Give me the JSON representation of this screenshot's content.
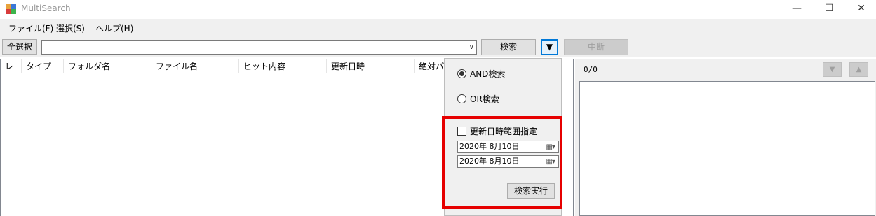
{
  "window": {
    "title": "MultiSearch",
    "minimize_glyph": "—",
    "maximize_glyph": "☐",
    "close_glyph": "✕"
  },
  "menu": [
    "ファイル(F)",
    "選択(S)",
    "ヘルプ(H)"
  ],
  "toolbar": {
    "select_all_label": "全選択",
    "search_value": "",
    "combo_arrow": "∨",
    "search_label": "検索",
    "dropdown_glyph": "▼",
    "stop_label": "中断"
  },
  "list": {
    "columns": [
      "レ",
      "タイプ",
      "フォルダ名",
      "ファイル名",
      "ヒット内容",
      "更新日時",
      "絶対パ"
    ]
  },
  "preview": {
    "counter": "0/0",
    "down_glyph": "▼",
    "up_glyph": "▲"
  },
  "options": {
    "and_label": "AND検索",
    "or_label": "OR検索",
    "and_selected": true,
    "date_range_label": "更新日時範囲指定",
    "date_from": "2020年  8月10日",
    "date_to": "2020年  8月10日",
    "calendar_glyph": "▦▾",
    "execute_label": "検索実行"
  },
  "colors": {
    "highlight": "#e60000",
    "focus": "#0078d7"
  }
}
